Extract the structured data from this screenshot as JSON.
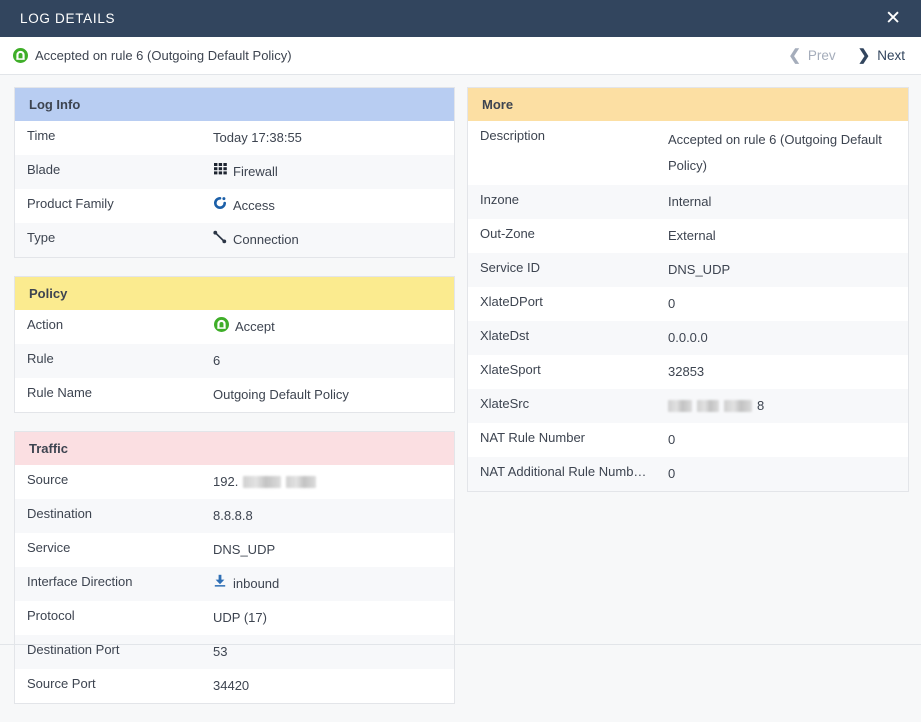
{
  "titlebar": {
    "title": "LOG DETAILS",
    "close_label": "✕"
  },
  "summary": {
    "status_icon": "accept-gateway-icon",
    "text": "Accepted on rule 6 (Outgoing Default Policy)",
    "prev_label": "Prev",
    "next_label": "Next",
    "prev_icon": "chevron-left-icon",
    "next_icon": "chevron-right-icon",
    "prev_enabled": false,
    "next_enabled": true
  },
  "colors": {
    "titlebar_bg": "#32455e",
    "loginfo_header_bg": "#b8cdf2",
    "policy_header_bg": "#fbeb8f",
    "traffic_header_bg": "#fbdfe2",
    "more_header_bg": "#fcdfa3",
    "accept_green": "#3fae29",
    "access_blue": "#1b5fa8",
    "link_blue": "#2f6fb5"
  },
  "sections": {
    "log_info": {
      "title": "Log Info",
      "rows": [
        {
          "label": "Time",
          "value": "Today 17:38:55",
          "icon": ""
        },
        {
          "label": "Blade",
          "value": "Firewall",
          "icon": "firewall-bricks-icon"
        },
        {
          "label": "Product Family",
          "value": "Access",
          "icon": "access-swirl-icon"
        },
        {
          "label": "Type",
          "value": "Connection",
          "icon": "connection-link-icon"
        }
      ]
    },
    "policy": {
      "title": "Policy",
      "rows": [
        {
          "label": "Action",
          "value": "Accept",
          "icon": "accept-gateway-icon"
        },
        {
          "label": "Rule",
          "value": "6",
          "icon": ""
        },
        {
          "label": "Rule Name",
          "value": "Outgoing Default Policy",
          "icon": ""
        }
      ]
    },
    "traffic": {
      "title": "Traffic",
      "rows": [
        {
          "label": "Source",
          "value": "192.",
          "icon": "",
          "redacted": true
        },
        {
          "label": "Destination",
          "value": "8.8.8.8",
          "icon": ""
        },
        {
          "label": "Service",
          "value": "DNS_UDP",
          "icon": ""
        },
        {
          "label": "Interface Direction",
          "value": "inbound",
          "icon": "download-arrow-icon"
        },
        {
          "label": "Protocol",
          "value": "UDP (17)",
          "icon": ""
        },
        {
          "label": "Destination Port",
          "value": "53",
          "icon": ""
        },
        {
          "label": "Source Port",
          "value": "34420",
          "icon": ""
        }
      ]
    },
    "more": {
      "title": "More",
      "rows": [
        {
          "label": "Description",
          "value": "Accepted on rule 6 (Outgoing Default Policy)",
          "icon": ""
        },
        {
          "label": "Inzone",
          "value": "Internal",
          "icon": ""
        },
        {
          "label": "Out-Zone",
          "value": "External",
          "icon": ""
        },
        {
          "label": "Service ID",
          "value": "DNS_UDP",
          "icon": ""
        },
        {
          "label": "XlateDPort",
          "value": "0",
          "icon": ""
        },
        {
          "label": "XlateDst",
          "value": "0.0.0.0",
          "icon": ""
        },
        {
          "label": "XlateSport",
          "value": "32853",
          "icon": ""
        },
        {
          "label": "XlateSrc",
          "value": "8",
          "icon": "",
          "redacted_prefix": true
        },
        {
          "label": "NAT Rule Number",
          "value": "0",
          "icon": ""
        },
        {
          "label": "NAT Additional Rule Numb…",
          "value": "0",
          "icon": ""
        }
      ]
    }
  }
}
